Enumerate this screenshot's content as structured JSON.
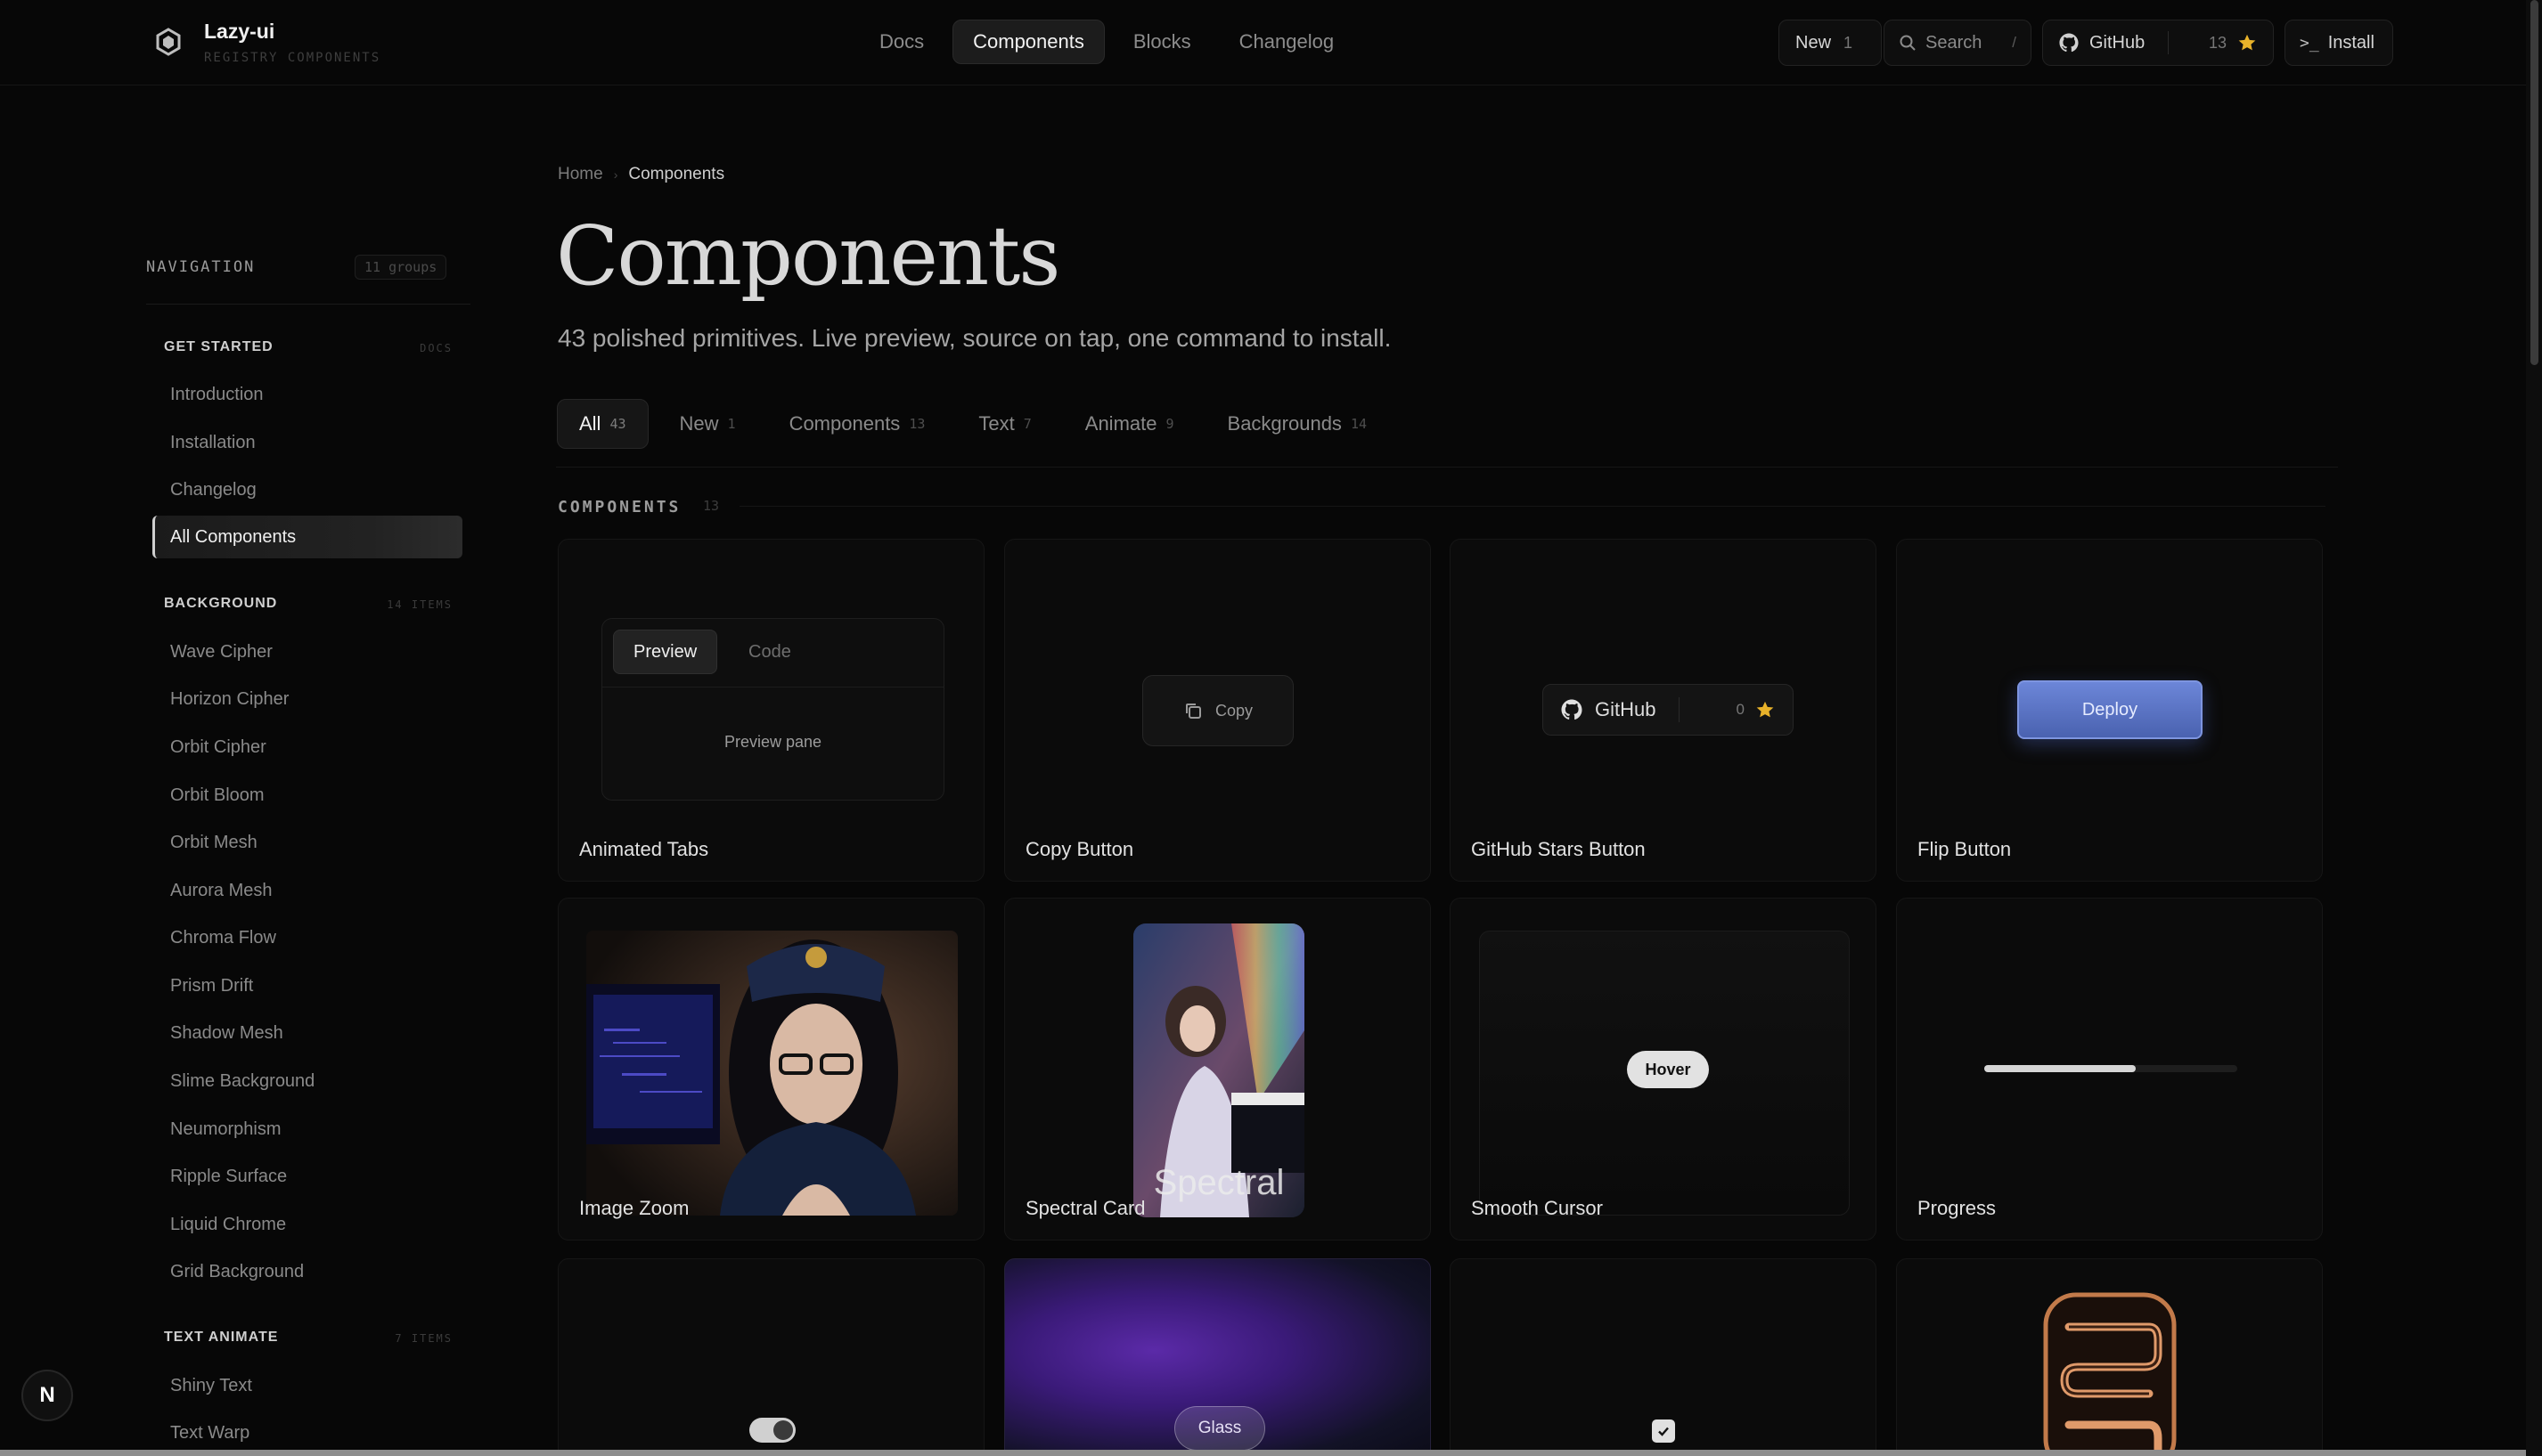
{
  "brand": {
    "name": "Lazy-ui",
    "subtitle": "REGISTRY COMPONENTS"
  },
  "topnav": [
    {
      "label": "Docs",
      "active": false
    },
    {
      "label": "Components",
      "active": true
    },
    {
      "label": "Blocks",
      "active": false
    },
    {
      "label": "Changelog",
      "active": false
    }
  ],
  "toolbar": {
    "new_label": "New",
    "new_count": "1",
    "search_label": "Search",
    "search_kbd": "/",
    "github_label": "GitHub",
    "github_count": "13",
    "install_prompt": ">_",
    "install_label": "Install"
  },
  "sidebar": {
    "heading": "NAVIGATION",
    "heading_count": "11 groups",
    "groups": [
      {
        "title": "GET STARTED",
        "meta": "DOCS",
        "items": [
          "Introduction",
          "Installation",
          "Changelog",
          "All Components"
        ],
        "active": "All Components"
      },
      {
        "title": "BACKGROUND",
        "meta": "14 ITEMS",
        "items": [
          "Wave Cipher",
          "Horizon Cipher",
          "Orbit Cipher",
          "Orbit Bloom",
          "Orbit Mesh",
          "Aurora Mesh",
          "Chroma Flow",
          "Prism Drift",
          "Shadow Mesh",
          "Slime Background",
          "Neumorphism",
          "Ripple Surface",
          "Liquid Chrome",
          "Grid Background"
        ]
      },
      {
        "title": "TEXT ANIMATE",
        "meta": "7 ITEMS",
        "items": [
          "Shiny Text",
          "Text Warp"
        ]
      }
    ],
    "badge": "N"
  },
  "breadcrumb": {
    "home": "Home",
    "sep": "›",
    "current": "Components"
  },
  "page": {
    "title": "Components",
    "subtitle": "43 polished primitives. Live preview, source on tap, one command to install."
  },
  "filters": [
    {
      "label": "All",
      "count": "43",
      "active": true
    },
    {
      "label": "New",
      "count": "1"
    },
    {
      "label": "Components",
      "count": "13"
    },
    {
      "label": "Text",
      "count": "7"
    },
    {
      "label": "Animate",
      "count": "9"
    },
    {
      "label": "Backgrounds",
      "count": "14"
    }
  ],
  "section": {
    "label": "COMPONENTS",
    "count": "13"
  },
  "cards": {
    "animated_tabs": {
      "name": "Animated Tabs",
      "tab1": "Preview",
      "tab2": "Code",
      "pane": "Preview pane"
    },
    "copy_button": {
      "name": "Copy Button",
      "label": "Copy"
    },
    "github_stars": {
      "name": "GitHub Stars Button",
      "label": "GitHub",
      "count": "0"
    },
    "flip_button": {
      "name": "Flip Button",
      "label": "Deploy"
    },
    "image_zoom": {
      "name": "Image Zoom"
    },
    "spectral_card": {
      "name": "Spectral Card",
      "overlay": "Spectral"
    },
    "smooth_cursor": {
      "name": "Smooth Cursor",
      "label": "Hover"
    },
    "progress": {
      "name": "Progress",
      "value": 0.6
    },
    "glass": {
      "label": "Glass"
    }
  },
  "colors": {
    "accent_star": "#e8b22a",
    "deploy": "#5a74c6",
    "glass_purple": "#5b2aa8"
  }
}
